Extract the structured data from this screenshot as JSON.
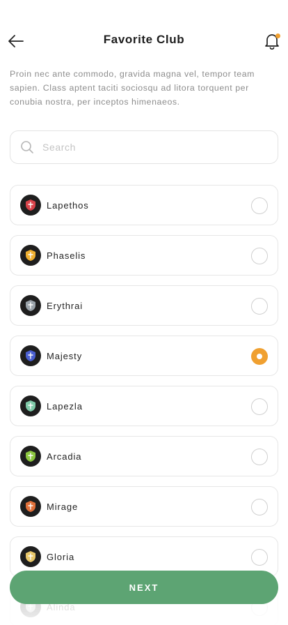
{
  "header": {
    "title": "Favorite Club",
    "back_icon": "arrow-left-icon",
    "bell_icon": "bell-icon",
    "badge_color": "#f0a030"
  },
  "intro": {
    "text": "Proin nec ante commodo, gravida magna vel, tempor team sapien. Class aptent taciti sociosqu ad litora torquent per conubia nostra, per inceptos himenaeos."
  },
  "search": {
    "placeholder": "Search",
    "value": "",
    "icon": "search-icon"
  },
  "clubs": [
    {
      "name": "Lapethos",
      "selected": false,
      "logo_icon": "club-crest-icon",
      "logo_color": "#d8434a"
    },
    {
      "name": "Phaselis",
      "selected": false,
      "logo_icon": "club-crest-icon",
      "logo_color": "#f0b030"
    },
    {
      "name": "Erythrai",
      "selected": false,
      "logo_icon": "club-crest-icon",
      "logo_color": "#9aa3aa"
    },
    {
      "name": "Majesty",
      "selected": true,
      "logo_icon": "club-crest-icon",
      "logo_color": "#4a5fd0"
    },
    {
      "name": "Lapezla",
      "selected": false,
      "logo_icon": "club-crest-icon",
      "logo_color": "#7fc9a8"
    },
    {
      "name": "Arcadia",
      "selected": false,
      "logo_icon": "club-crest-icon",
      "logo_color": "#8cc63f"
    },
    {
      "name": "Mirage",
      "selected": false,
      "logo_icon": "club-crest-icon",
      "logo_color": "#e0703a"
    },
    {
      "name": "Gloria",
      "selected": false,
      "logo_icon": "club-crest-icon",
      "logo_color": "#e8c76a"
    },
    {
      "name": "Alinda",
      "selected": false,
      "logo_icon": "club-crest-icon",
      "logo_color": "#bbbbbb"
    }
  ],
  "accent_color": "#f0a030",
  "primary_color": "#5da473",
  "next_button": {
    "label": "NEXT"
  }
}
